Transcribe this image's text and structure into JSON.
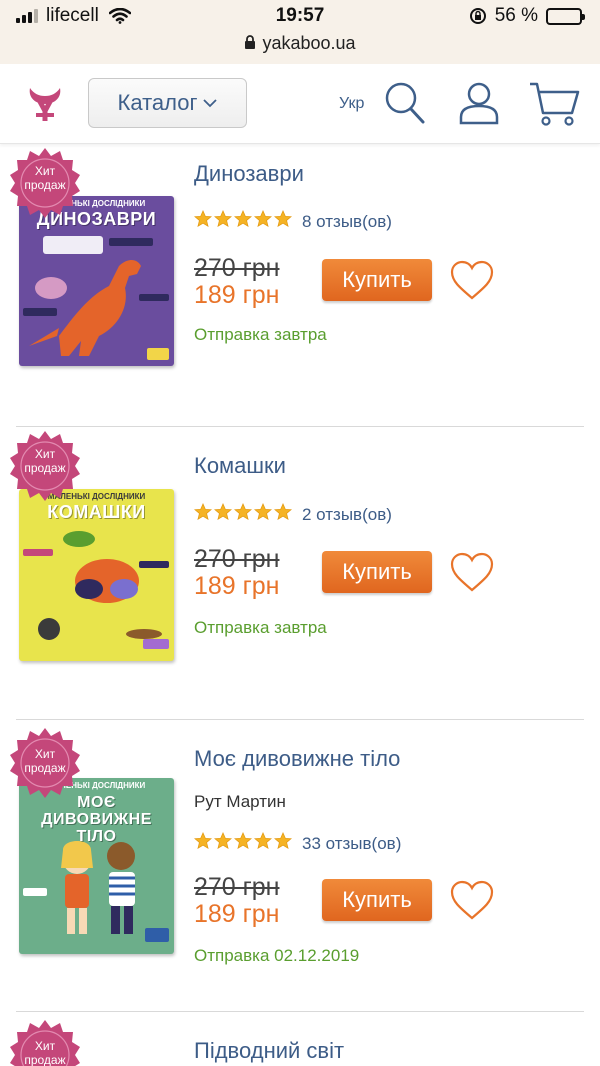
{
  "status_bar": {
    "carrier": "lifecell",
    "time": "19:57",
    "battery": "56 %",
    "battery_level": 0.56,
    "url": "yakaboo.ua"
  },
  "header": {
    "catalog_label": "Каталог",
    "lang_label": "Укр",
    "icons": [
      "logo-icon",
      "search-icon",
      "user-icon",
      "cart-icon"
    ]
  },
  "colors": {
    "accent_orange": "#e8742a",
    "link_blue": "#3d5c87",
    "ship_green": "#5a9e2f",
    "badge_pink": "#c4477a"
  },
  "products": [
    {
      "badge": "Хит\nпродаж",
      "title": "Динозаври",
      "author": "",
      "rating": 5,
      "reviews": "8 отзыв(ов)",
      "old_price": "270 грн",
      "new_price": "189 грн",
      "buy_label": "Купить",
      "shipping": "Отправка завтра",
      "cover": {
        "series": "МАЛЕНЬКІ ДОСЛІДНИКИ",
        "title": "ДИНОЗАВРИ",
        "bg": "#6a4d9e"
      }
    },
    {
      "badge": "Хит\nпродаж",
      "title": "Комашки",
      "author": "",
      "rating": 5,
      "reviews": "2 отзыв(ов)",
      "old_price": "270 грн",
      "new_price": "189 грн",
      "buy_label": "Купить",
      "shipping": "Отправка завтра",
      "cover": {
        "series": "МАЛЕНЬКІ ДОСЛІДНИКИ",
        "title": "КОМАШКИ",
        "bg": "#e8e44c"
      }
    },
    {
      "badge": "Хит\nпродаж",
      "title": "Моє дивовижне тіло",
      "author": "Рут Мартин",
      "rating": 5,
      "reviews": "33 отзыв(ов)",
      "old_price": "270 грн",
      "new_price": "189 грн",
      "buy_label": "Купить",
      "shipping": "Отправка 02.12.2019",
      "cover": {
        "series": "МАЛЕНЬКІ ДОСЛІДНИКИ",
        "title": "МОЄ ДИВОВИЖНЕ ТІЛО",
        "bg": "#6cae8a"
      }
    },
    {
      "badge": "Хит\nпродаж",
      "title": "Підводний світ"
    }
  ]
}
